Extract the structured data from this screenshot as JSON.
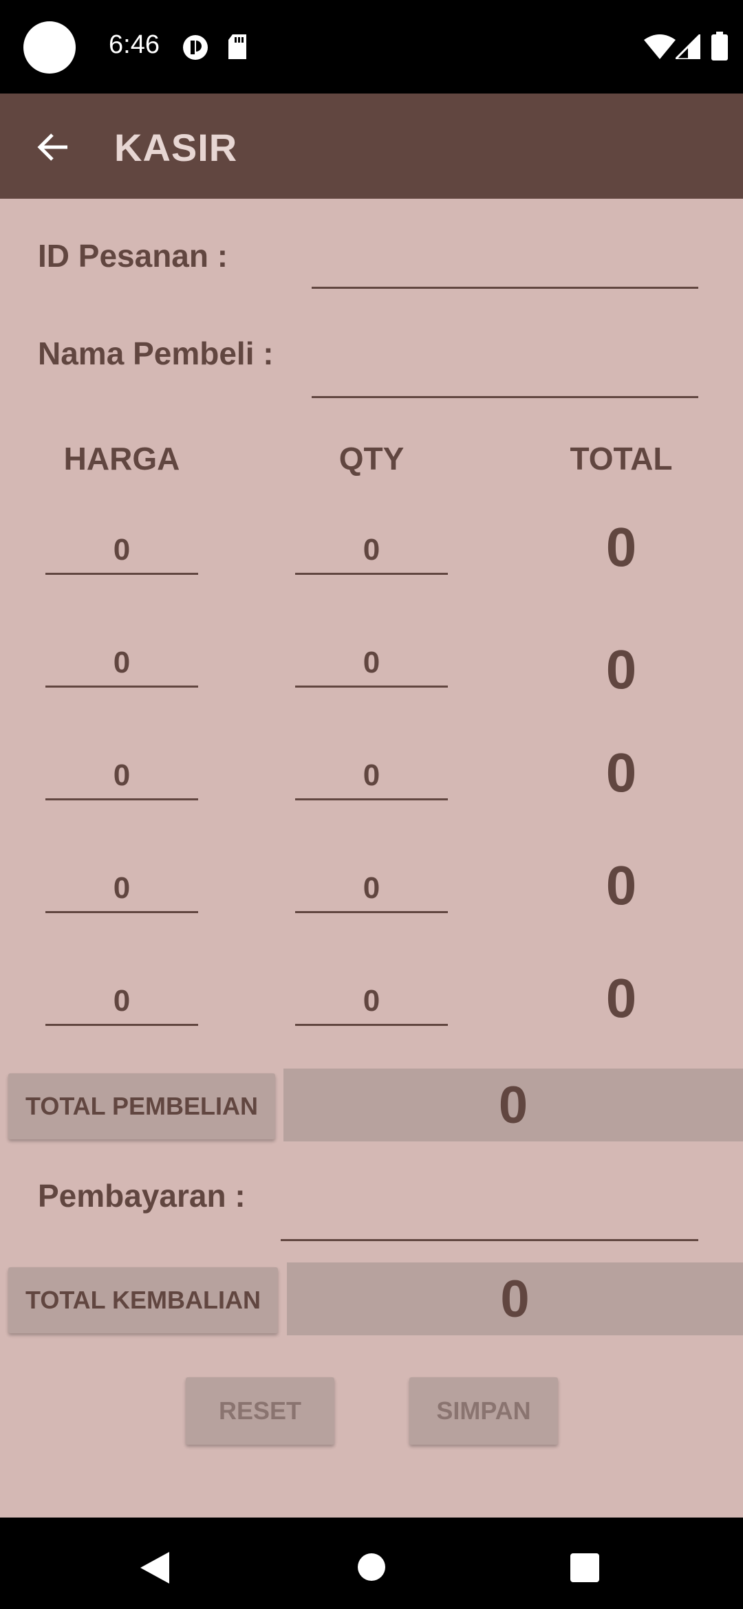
{
  "status_bar": {
    "time": "6:46",
    "icons": [
      "notification-app-icon",
      "sd-card-icon",
      "wifi-icon",
      "signal-icon",
      "battery-icon"
    ]
  },
  "app_bar": {
    "title": "KASIR",
    "back_icon": "arrow-back-icon"
  },
  "form": {
    "id_label": "ID Pesanan :",
    "id_value": "",
    "name_label": "Nama Pembeli :",
    "name_value": ""
  },
  "table": {
    "headers": [
      "HARGA",
      "QTY",
      "TOTAL"
    ],
    "rows": [
      {
        "harga": "0",
        "qty": "0",
        "total": "0"
      },
      {
        "harga": "0",
        "qty": "0",
        "total": "0"
      },
      {
        "harga": "0",
        "qty": "0",
        "total": "0"
      },
      {
        "harga": "0",
        "qty": "0",
        "total": "0"
      },
      {
        "harga": "0",
        "qty": "0",
        "total": "0"
      }
    ]
  },
  "summary": {
    "total_pembelian_label": "TOTAL PEMBELIAN",
    "total_pembelian_value": "0",
    "pembayaran_label": "Pembayaran :",
    "pembayaran_value": "",
    "total_kembalian_label": "TOTAL KEMBALIAN",
    "total_kembalian_value": "0"
  },
  "actions": {
    "reset_label": "RESET",
    "simpan_label": "SIMPAN"
  },
  "colors": {
    "app_bar": "#614640",
    "background": "#d4b8b4",
    "text": "#614640",
    "button": "#b7a29e"
  }
}
